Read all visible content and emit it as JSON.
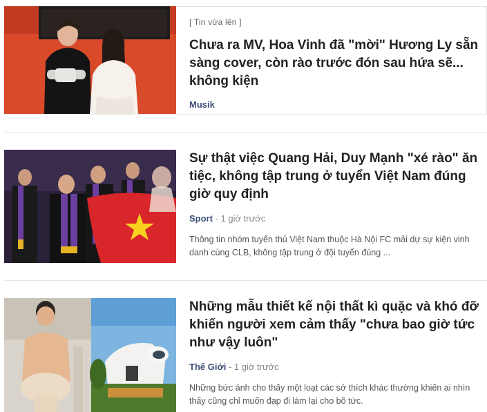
{
  "articles": [
    {
      "tag": "[ Tin vừa lên ]",
      "title": "Chưa ra MV, Hoa Vinh đã \"mời\" Hương Ly sẵn sàng cover, còn rào trước đón sau hứa sẽ... không kiện",
      "category": "Musik",
      "time": "",
      "description": ""
    },
    {
      "tag": "",
      "title": "Sự thật việc Quang Hải, Duy Mạnh \"xé rào\" ăn tiệc, không tập trung ở tuyển Việt Nam đúng giờ quy định",
      "category": "Sport",
      "separator": "-",
      "time": "1 giờ trước",
      "description": "Thông tin nhóm tuyển thủ Việt Nam thuộc Hà Nội FC mải dự sự kiện vinh danh cùng CLB, không tập trung ở đội tuyển đúng ..."
    },
    {
      "tag": "",
      "title": "Những mẫu thiết kế nội thất kì quặc và khó đỡ khiến người xem cảm thấy \"chưa bao giờ tức như vậy luôn\"",
      "category": "Thế Giới",
      "separator": "-",
      "time": "1 giờ trước",
      "description": "Những bức ảnh cho thấy một loạt các sở thích khác thường khiến ai nhìn thấy cũng chỉ muốn đạp đi làm lại cho bõ tức."
    }
  ],
  "colors": {
    "category": "#3d4f79",
    "title": "#222222",
    "divider": "#e6e6e6"
  }
}
